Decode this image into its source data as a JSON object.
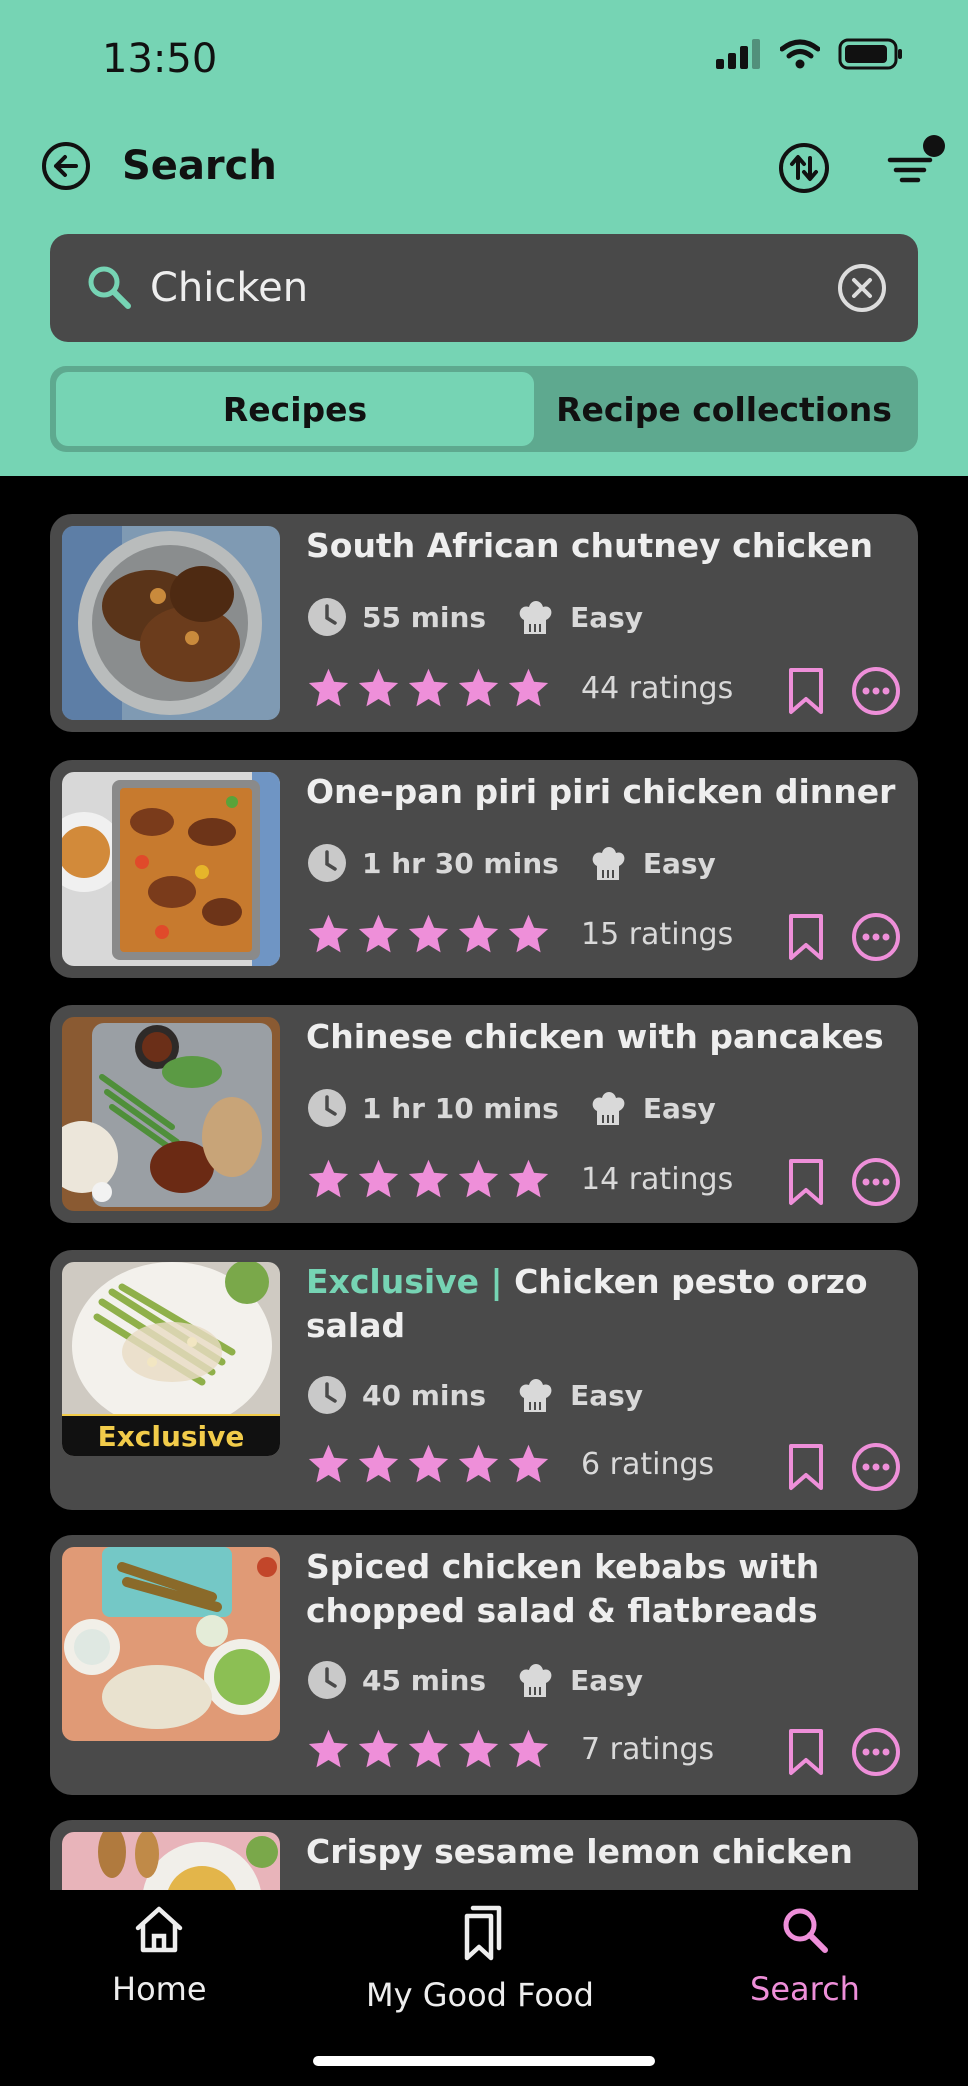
{
  "status_bar": {
    "time": "13:50"
  },
  "nav": {
    "title": "Search"
  },
  "search": {
    "value": "Chicken"
  },
  "tabs": [
    {
      "label": "Recipes",
      "active": true
    },
    {
      "label": "Recipe collections",
      "active": false
    }
  ],
  "recipes": [
    {
      "title": "South African chutney chicken",
      "time": "55 mins",
      "difficulty": "Easy",
      "stars": 5,
      "ratings": "44 ratings"
    },
    {
      "title": "One-pan piri piri chicken dinner",
      "time": "1 hr 30 mins",
      "difficulty": "Easy",
      "stars": 5,
      "ratings": "15 ratings"
    },
    {
      "title": "Chinese chicken with pancakes",
      "time": "1 hr 10 mins",
      "difficulty": "Easy",
      "stars": 5,
      "ratings": "14 ratings"
    },
    {
      "title_prefix": "Exclusive | ",
      "title": "Chicken pesto orzo salad",
      "time": "40 mins",
      "difficulty": "Easy",
      "stars": 5,
      "ratings": "6 ratings",
      "badge": "Exclusive"
    },
    {
      "title": "Spiced chicken kebabs with chopped salad & flatbreads",
      "time": "45 mins",
      "difficulty": "Easy",
      "stars": 5,
      "ratings": "7 ratings"
    },
    {
      "title": "Crispy sesame lemon chicken"
    }
  ],
  "bottom_nav": [
    {
      "label": "Home",
      "icon": "home-icon"
    },
    {
      "label": "My Good Food",
      "icon": "bookmarks-icon"
    },
    {
      "label": "Search",
      "icon": "search-icon",
      "active": true
    }
  ],
  "colors": {
    "accent": "#76d4b4",
    "star": "#ee8fd9",
    "card": "#4a4a4a",
    "exclusive_badge": "#f2cc4a"
  }
}
